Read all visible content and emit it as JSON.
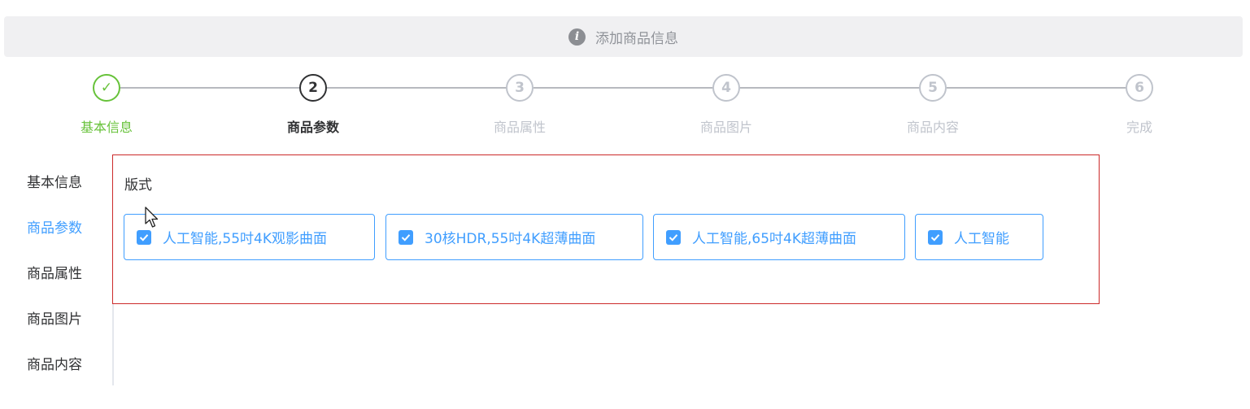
{
  "alert": {
    "text": "添加商品信息",
    "icon": "info-icon"
  },
  "steps": [
    {
      "number": "✓",
      "label": "基本信息",
      "status": "done"
    },
    {
      "number": "2",
      "label": "商品参数",
      "status": "active"
    },
    {
      "number": "3",
      "label": "商品属性",
      "status": "wait"
    },
    {
      "number": "4",
      "label": "商品图片",
      "status": "wait"
    },
    {
      "number": "5",
      "label": "商品内容",
      "status": "wait"
    },
    {
      "number": "6",
      "label": "完成",
      "status": "wait"
    }
  ],
  "tabs": [
    {
      "label": "基本信息",
      "active": false
    },
    {
      "label": "商品参数",
      "active": true
    },
    {
      "label": "商品属性",
      "active": false
    },
    {
      "label": "商品图片",
      "active": false
    },
    {
      "label": "商品内容",
      "active": false
    }
  ],
  "panel": {
    "title": "版式",
    "options": [
      {
        "label": "人工智能,55吋4K观影曲面",
        "checked": true
      },
      {
        "label": "30核HDR,55吋4K超薄曲面",
        "checked": true
      },
      {
        "label": "人工智能,65吋4K超薄曲面",
        "checked": true
      },
      {
        "label": "人工智能",
        "checked": true
      }
    ]
  },
  "colors": {
    "primary": "#409eff",
    "success": "#67c23a",
    "inactive": "#c0c4cc",
    "highlight_border": "#cc2a2a"
  }
}
